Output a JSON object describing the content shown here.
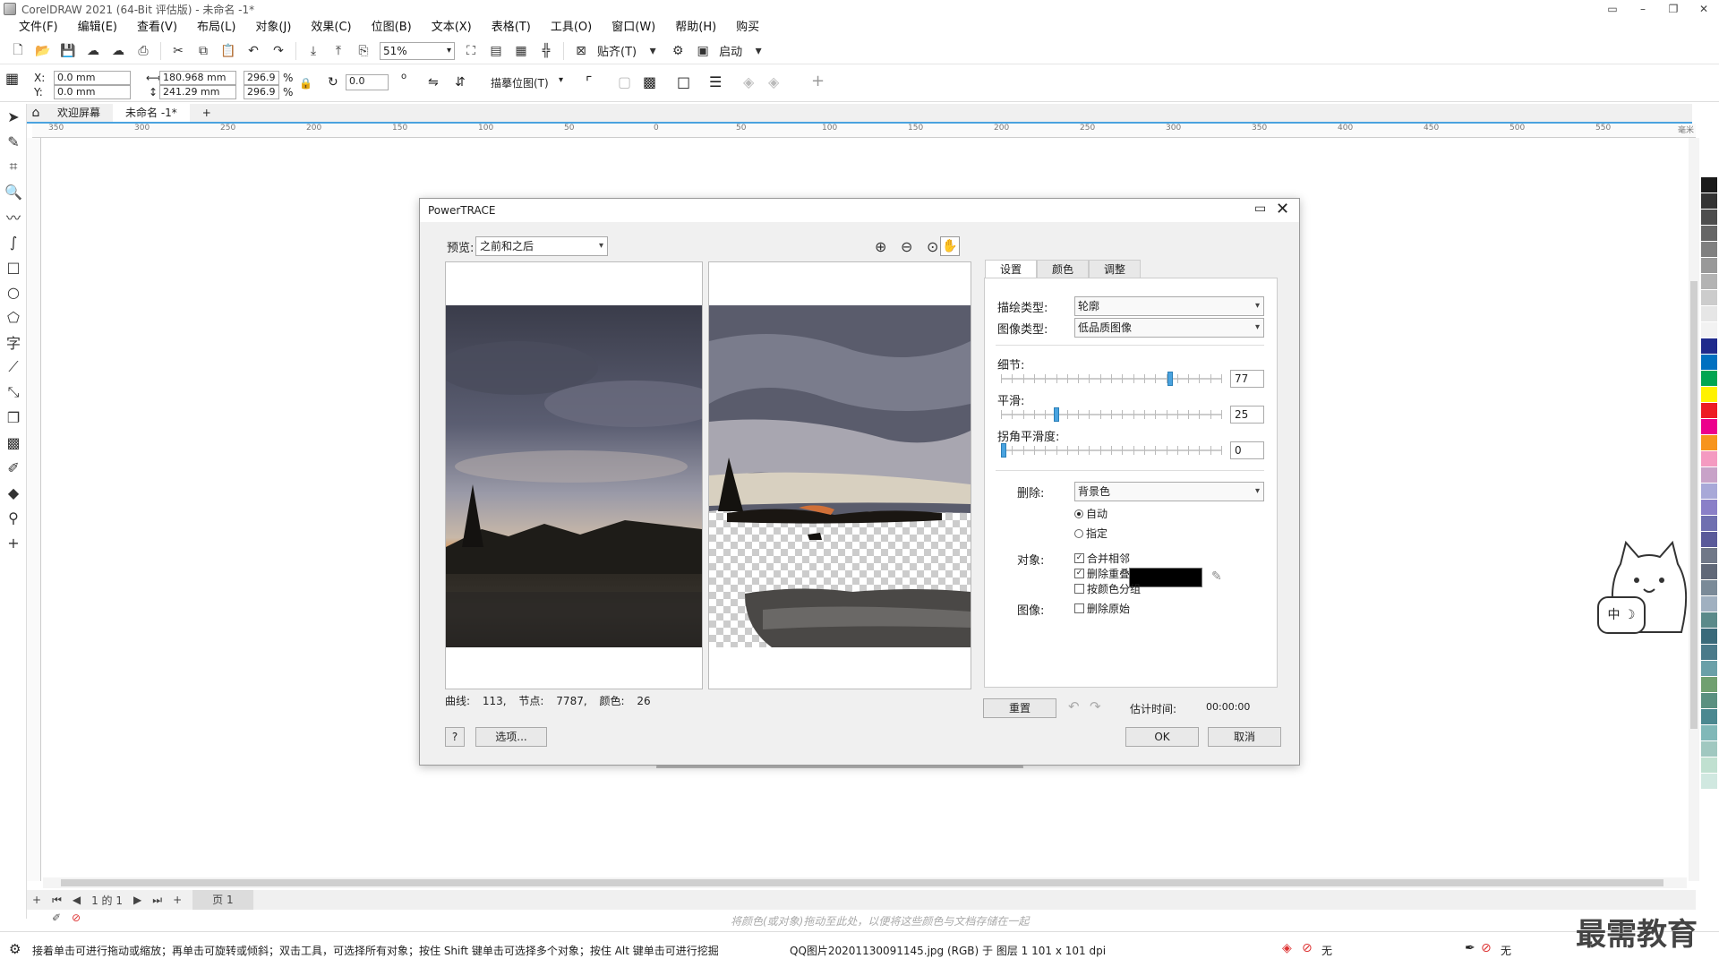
{
  "window": {
    "title": "CorelDRAW 2021 (64-Bit 评估版) - 未命名 -1*",
    "controls": [
      "▭",
      "–",
      "❐",
      "✕"
    ]
  },
  "menu": [
    "文件(F)",
    "编辑(E)",
    "查看(V)",
    "布局(L)",
    "对象(J)",
    "效果(C)",
    "位图(B)",
    "文本(X)",
    "表格(T)",
    "工具(O)",
    "窗口(W)",
    "帮助(H)",
    "购买"
  ],
  "toolbar": {
    "zoom": "51%",
    "snap_label": "贴齐(T)",
    "launch_label": "启动"
  },
  "propbar": {
    "x_label": "X:",
    "y_label": "Y:",
    "x_value": "0.0 mm",
    "y_value": "0.0 mm",
    "width_value": "180.968 mm",
    "height_value": "241.29 mm",
    "scale_x": "296.9",
    "scale_y": "296.9",
    "percent": "%",
    "rotation": "0.0",
    "degree": "o",
    "trace_bitmap_label": "描摹位图(T)"
  },
  "tabs": {
    "welcome": "欢迎屏幕",
    "document": "未命名 -1*",
    "add": "+"
  },
  "ruler": {
    "labels": [
      "350",
      "300",
      "250",
      "200",
      "150",
      "100",
      "50",
      "0",
      "50",
      "100",
      "150",
      "200",
      "250",
      "300",
      "350",
      "400",
      "450",
      "500",
      "550",
      "毫米"
    ]
  },
  "dialog": {
    "title": "PowerTRACE",
    "preview_label": "预览:",
    "preview_value": "之前和之后",
    "tabs": [
      "设置",
      "颜色",
      "调整"
    ],
    "trace_type_label": "描绘类型:",
    "trace_type_value": "轮廓",
    "image_type_label": "图像类型:",
    "image_type_value": "低品质图像",
    "detail_label": "细节:",
    "detail": 77,
    "smoothing_label": "平滑:",
    "smoothing": 25,
    "corner_label": "拐角平滑度:",
    "corner": 0,
    "delete_label": "删除:",
    "delete_value": "背景色",
    "auto_label": "自动",
    "specify_label": "指定",
    "object_label": "对象:",
    "merge_label": "合并相邻",
    "remove_overlap_label": "删除重叠",
    "group_by_color_label": "按颜色分组",
    "image_label": "图像:",
    "delete_original_label": "删除原始",
    "curves_label": "曲线:",
    "curves_value": "113,",
    "nodes_label": "节点:",
    "nodes_value": "7787,",
    "colors_label": "颜色:",
    "colors_value": "26",
    "reset_label": "重置",
    "estimate_label": "估计时间:",
    "estimate_value": "00:00:00",
    "help_label": "?",
    "options_label": "选项...",
    "ok_label": "OK",
    "cancel_label": "取消",
    "specify_color": "#000000"
  },
  "pagenav": {
    "page_of": "1 的 1",
    "page_tab": "页 1"
  },
  "hint": "将颜色(或对象)拖动至此处，以便将这些颜色与文档存储在一起",
  "status": {
    "tip": "接着单击可进行拖动或缩放；再单击可旋转或倾斜；双击工具，可选择所有对象；按住 Shift 键单击可选择多个对象；按住 Alt 键单击可进行挖掘",
    "object_info": "QQ图片20201130091145.jpg (RGB) 于 图层 1 101 x 101 dpi",
    "fill_label": "无",
    "outline_label": "无"
  },
  "ime": "中 ☽",
  "watermark": "最需教育",
  "palette_colors": [
    "#ffffff",
    "#1a1a1a",
    "#333333",
    "#4d4d4d",
    "#666666",
    "#808080",
    "#999999",
    "#b3b3b3",
    "#cccccc",
    "#e6e6e6",
    "#f2f2f2",
    "#1f2a8c",
    "#0070c0",
    "#00a651",
    "#fff200",
    "#ed1c24",
    "#ec008c",
    "#f7941d",
    "#f49ac1",
    "#c8a2c8",
    "#a8a8d8",
    "#8a7fc8",
    "#6f6fb0",
    "#5a5a9a",
    "#707888",
    "#606878",
    "#7a8a98",
    "#a0b0c0",
    "#5a8a8a",
    "#3a6a7a",
    "#4a7a8a",
    "#6aa0a8",
    "#70a070",
    "#5a9080",
    "#4a8890",
    "#80b8b8",
    "#a0c8c0",
    "#c0e0d0",
    "#d0e8e0"
  ]
}
